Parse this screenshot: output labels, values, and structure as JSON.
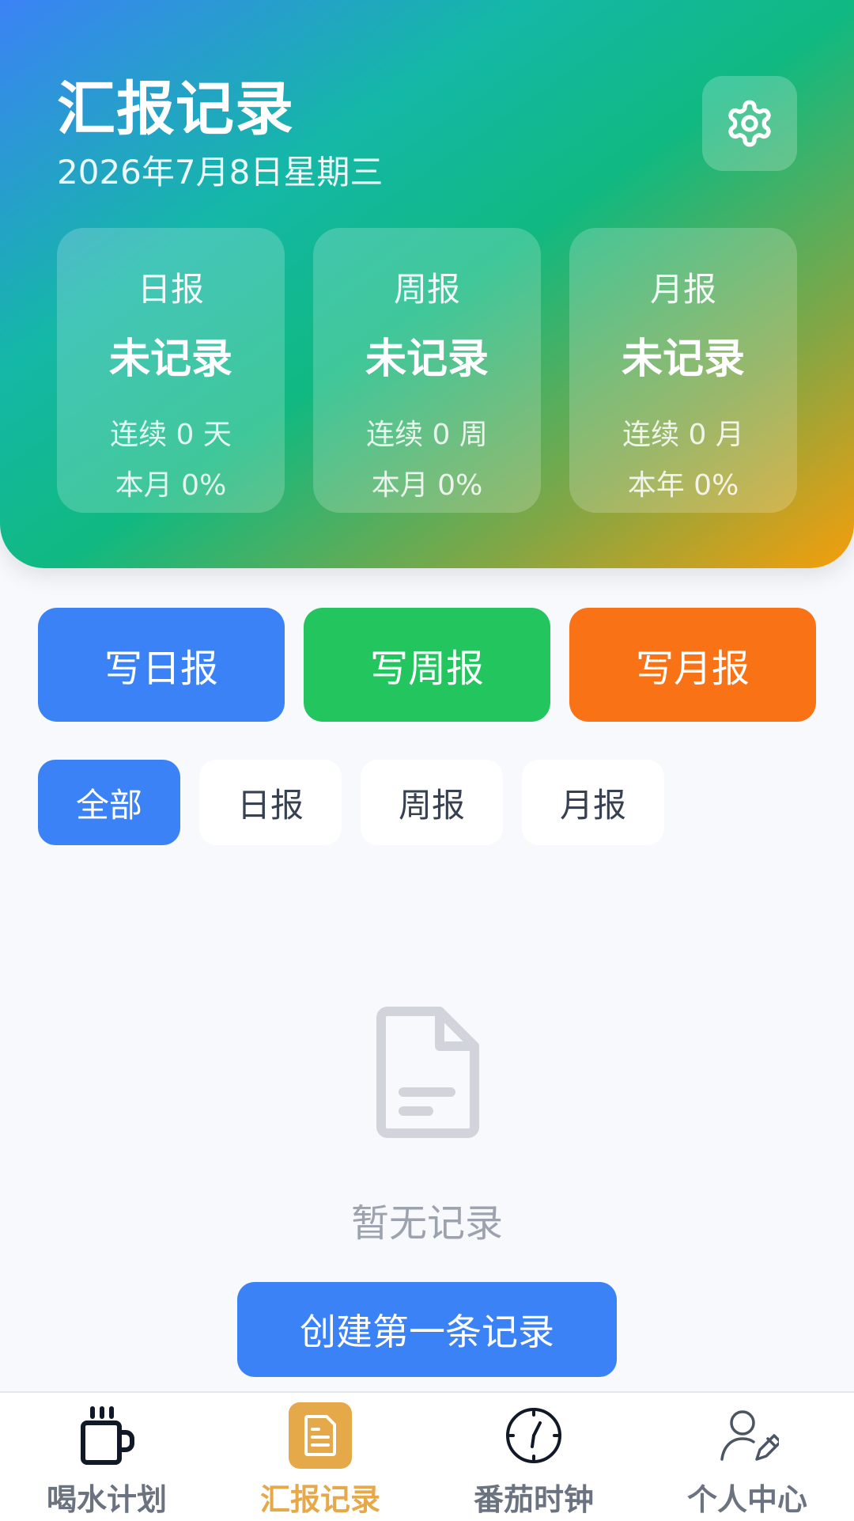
{
  "header": {
    "title": "汇报记录",
    "date": "2026年7月8日星期三"
  },
  "stats": [
    {
      "label": "日报",
      "status": "未记录",
      "streak": "连续 0 天",
      "rate": "本月 0%"
    },
    {
      "label": "周报",
      "status": "未记录",
      "streak": "连续 0 周",
      "rate": "本月 0%"
    },
    {
      "label": "月报",
      "status": "未记录",
      "streak": "连续 0 月",
      "rate": "本年 0%"
    }
  ],
  "actions": [
    {
      "label": "写日报",
      "color": "#3b82f6"
    },
    {
      "label": "写周报",
      "color": "#22c55e"
    },
    {
      "label": "写月报",
      "color": "#f97316"
    }
  ],
  "filters": {
    "tabs": [
      "全部",
      "日报",
      "周报",
      "月报"
    ],
    "active": "全部"
  },
  "empty": {
    "text": "暂无记录",
    "button": "创建第一条记录"
  },
  "nav": {
    "items": [
      {
        "label": "喝水计划",
        "icon": "mug-icon"
      },
      {
        "label": "汇报记录",
        "icon": "document-icon"
      },
      {
        "label": "番茄时钟",
        "icon": "clock-icon"
      },
      {
        "label": "个人中心",
        "icon": "user-edit-icon"
      }
    ],
    "active": "汇报记录",
    "accent": "#e6a94a"
  }
}
